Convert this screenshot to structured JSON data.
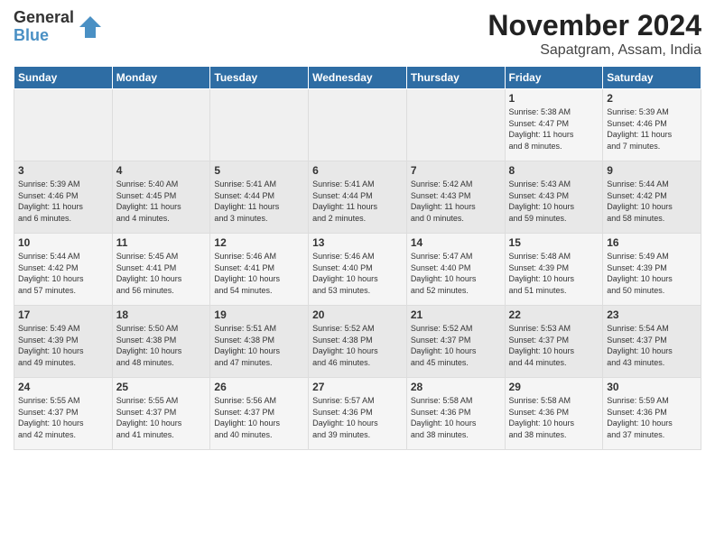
{
  "logo": {
    "general": "General",
    "blue": "Blue"
  },
  "title": "November 2024",
  "subtitle": "Sapatgram, Assam, India",
  "days_of_week": [
    "Sunday",
    "Monday",
    "Tuesday",
    "Wednesday",
    "Thursday",
    "Friday",
    "Saturday"
  ],
  "weeks": [
    [
      {
        "day": "",
        "content": ""
      },
      {
        "day": "",
        "content": ""
      },
      {
        "day": "",
        "content": ""
      },
      {
        "day": "",
        "content": ""
      },
      {
        "day": "",
        "content": ""
      },
      {
        "day": "1",
        "content": "Sunrise: 5:38 AM\nSunset: 4:47 PM\nDaylight: 11 hours\nand 8 minutes."
      },
      {
        "day": "2",
        "content": "Sunrise: 5:39 AM\nSunset: 4:46 PM\nDaylight: 11 hours\nand 7 minutes."
      }
    ],
    [
      {
        "day": "3",
        "content": "Sunrise: 5:39 AM\nSunset: 4:46 PM\nDaylight: 11 hours\nand 6 minutes."
      },
      {
        "day": "4",
        "content": "Sunrise: 5:40 AM\nSunset: 4:45 PM\nDaylight: 11 hours\nand 4 minutes."
      },
      {
        "day": "5",
        "content": "Sunrise: 5:41 AM\nSunset: 4:44 PM\nDaylight: 11 hours\nand 3 minutes."
      },
      {
        "day": "6",
        "content": "Sunrise: 5:41 AM\nSunset: 4:44 PM\nDaylight: 11 hours\nand 2 minutes."
      },
      {
        "day": "7",
        "content": "Sunrise: 5:42 AM\nSunset: 4:43 PM\nDaylight: 11 hours\nand 0 minutes."
      },
      {
        "day": "8",
        "content": "Sunrise: 5:43 AM\nSunset: 4:43 PM\nDaylight: 10 hours\nand 59 minutes."
      },
      {
        "day": "9",
        "content": "Sunrise: 5:44 AM\nSunset: 4:42 PM\nDaylight: 10 hours\nand 58 minutes."
      }
    ],
    [
      {
        "day": "10",
        "content": "Sunrise: 5:44 AM\nSunset: 4:42 PM\nDaylight: 10 hours\nand 57 minutes."
      },
      {
        "day": "11",
        "content": "Sunrise: 5:45 AM\nSunset: 4:41 PM\nDaylight: 10 hours\nand 56 minutes."
      },
      {
        "day": "12",
        "content": "Sunrise: 5:46 AM\nSunset: 4:41 PM\nDaylight: 10 hours\nand 54 minutes."
      },
      {
        "day": "13",
        "content": "Sunrise: 5:46 AM\nSunset: 4:40 PM\nDaylight: 10 hours\nand 53 minutes."
      },
      {
        "day": "14",
        "content": "Sunrise: 5:47 AM\nSunset: 4:40 PM\nDaylight: 10 hours\nand 52 minutes."
      },
      {
        "day": "15",
        "content": "Sunrise: 5:48 AM\nSunset: 4:39 PM\nDaylight: 10 hours\nand 51 minutes."
      },
      {
        "day": "16",
        "content": "Sunrise: 5:49 AM\nSunset: 4:39 PM\nDaylight: 10 hours\nand 50 minutes."
      }
    ],
    [
      {
        "day": "17",
        "content": "Sunrise: 5:49 AM\nSunset: 4:39 PM\nDaylight: 10 hours\nand 49 minutes."
      },
      {
        "day": "18",
        "content": "Sunrise: 5:50 AM\nSunset: 4:38 PM\nDaylight: 10 hours\nand 48 minutes."
      },
      {
        "day": "19",
        "content": "Sunrise: 5:51 AM\nSunset: 4:38 PM\nDaylight: 10 hours\nand 47 minutes."
      },
      {
        "day": "20",
        "content": "Sunrise: 5:52 AM\nSunset: 4:38 PM\nDaylight: 10 hours\nand 46 minutes."
      },
      {
        "day": "21",
        "content": "Sunrise: 5:52 AM\nSunset: 4:37 PM\nDaylight: 10 hours\nand 45 minutes."
      },
      {
        "day": "22",
        "content": "Sunrise: 5:53 AM\nSunset: 4:37 PM\nDaylight: 10 hours\nand 44 minutes."
      },
      {
        "day": "23",
        "content": "Sunrise: 5:54 AM\nSunset: 4:37 PM\nDaylight: 10 hours\nand 43 minutes."
      }
    ],
    [
      {
        "day": "24",
        "content": "Sunrise: 5:55 AM\nSunset: 4:37 PM\nDaylight: 10 hours\nand 42 minutes."
      },
      {
        "day": "25",
        "content": "Sunrise: 5:55 AM\nSunset: 4:37 PM\nDaylight: 10 hours\nand 41 minutes."
      },
      {
        "day": "26",
        "content": "Sunrise: 5:56 AM\nSunset: 4:37 PM\nDaylight: 10 hours\nand 40 minutes."
      },
      {
        "day": "27",
        "content": "Sunrise: 5:57 AM\nSunset: 4:36 PM\nDaylight: 10 hours\nand 39 minutes."
      },
      {
        "day": "28",
        "content": "Sunrise: 5:58 AM\nSunset: 4:36 PM\nDaylight: 10 hours\nand 38 minutes."
      },
      {
        "day": "29",
        "content": "Sunrise: 5:58 AM\nSunset: 4:36 PM\nDaylight: 10 hours\nand 38 minutes."
      },
      {
        "day": "30",
        "content": "Sunrise: 5:59 AM\nSunset: 4:36 PM\nDaylight: 10 hours\nand 37 minutes."
      }
    ]
  ]
}
